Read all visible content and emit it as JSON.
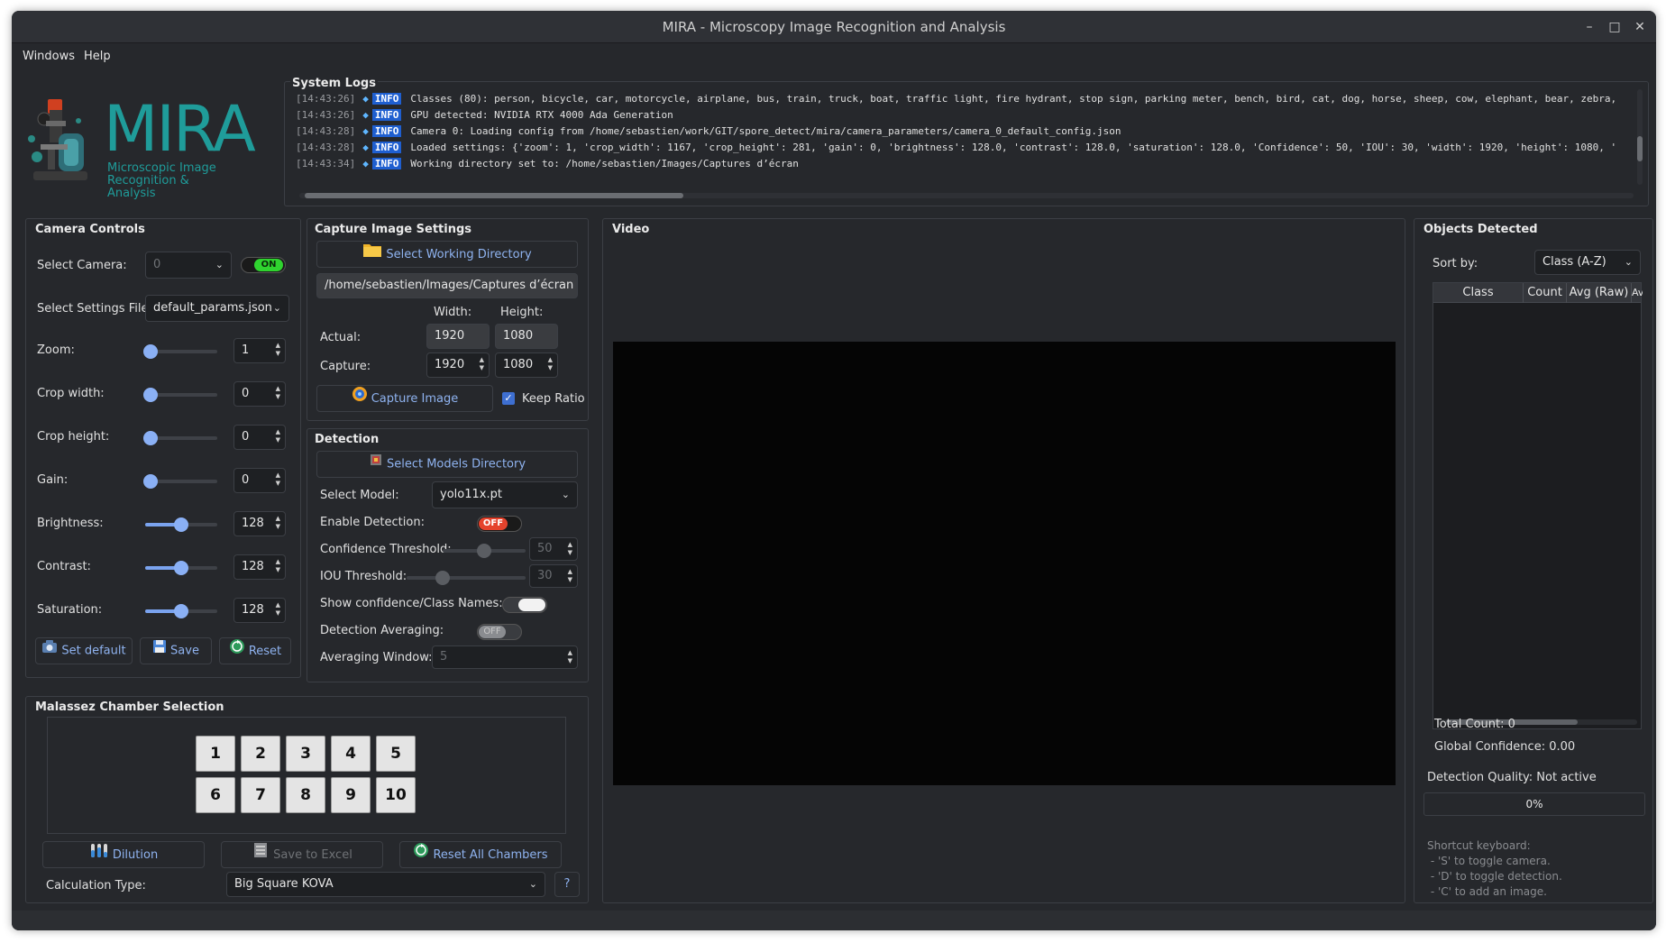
{
  "window": {
    "title": "MIRA - Microscopy Image Recognition and Analysis"
  },
  "menu": [
    "Windows",
    "Help"
  ],
  "logo": {
    "name": "MIRA",
    "subtitle_line1": "Microscopic Image",
    "subtitle_line2": "Recognition & Analysis"
  },
  "logs": {
    "title": "System Logs",
    "lines": [
      {
        "time": "[14:43:26]",
        "level": "INFO",
        "msg": "Classes (80): person, bicycle, car, motorcycle, airplane, bus, train, truck, boat, traffic light, fire hydrant, stop sign, parking meter, bench, bird, cat, dog, horse, sheep, cow, elephant, bear, zebra,"
      },
      {
        "time": "[14:43:26]",
        "level": "INFO",
        "msg": "GPU detected: NVIDIA RTX 4000 Ada Generation"
      },
      {
        "time": "[14:43:28]",
        "level": "INFO",
        "msg": "Camera 0: Loading config from /home/sebastien/work/GIT/spore_detect/mira/camera_parameters/camera_0_default_config.json"
      },
      {
        "time": "[14:43:28]",
        "level": "INFO",
        "msg": "Loaded settings: {'zoom': 1, 'crop_width': 1167, 'crop_height': 281, 'gain': 0, 'brightness': 128.0, 'contrast': 128.0, 'saturation': 128.0, 'Confidence': 50, 'IOU': 30, 'width': 1920, 'height': 1080, '"
      },
      {
        "time": "[14:43:34]",
        "level": "INFO",
        "msg": "Working directory set to: /home/sebastien/Images/Captures d’écran"
      }
    ]
  },
  "camera": {
    "title": "Camera Controls",
    "select_camera_label": "Select Camera:",
    "camera_value": "0",
    "camera_toggle": "ON",
    "settings_file_label": "Select Settings File:",
    "settings_file": "default_params.json",
    "sliders": [
      {
        "label": "Zoom:",
        "value": "1",
        "fraction": 0.0
      },
      {
        "label": "Crop width:",
        "value": "0",
        "fraction": 0.0
      },
      {
        "label": "Crop height:",
        "value": "0",
        "fraction": 0.0
      },
      {
        "label": "Gain:",
        "value": "0",
        "fraction": 0.0
      },
      {
        "label": "Brightness:",
        "value": "128",
        "fraction": 0.5
      },
      {
        "label": "Contrast:",
        "value": "128",
        "fraction": 0.5
      },
      {
        "label": "Saturation:",
        "value": "128",
        "fraction": 0.5
      }
    ],
    "set_default": "Set default",
    "save": "Save",
    "reset": "Reset"
  },
  "capture": {
    "title": "Capture Image Settings",
    "select_dir": "Select Working Directory",
    "dir_path": "/home/sebastien/Images/Captures d’écran",
    "width_label": "Width:",
    "height_label": "Height:",
    "actual_label": "Actual:",
    "actual_width": "1920",
    "actual_height": "1080",
    "capture_label": "Capture:",
    "capture_width": "1920",
    "capture_height": "1080",
    "capture_button": "Capture Image",
    "keep_ratio": "Keep Ratio"
  },
  "detection": {
    "title": "Detection",
    "select_models": "Select Models Directory",
    "select_model_label": "Select Model:",
    "model": "yolo11x.pt",
    "enable_label": "Enable Detection:",
    "enable_state": "OFF",
    "confidence_label": "Confidence Threshold:",
    "confidence_value": "50",
    "iou_label": "IOU Threshold:",
    "iou_value": "30",
    "show_names_label": "Show confidence/Class Names:",
    "averaging_label": "Detection Averaging:",
    "averaging_state": "OFF",
    "window_label": "Averaging Window:",
    "window_value": "5"
  },
  "video": {
    "title": "Video"
  },
  "objects": {
    "title": "Objects Detected",
    "sort_label": "Sort by:",
    "sort_value": "Class (A-Z)",
    "columns": [
      "Class",
      "Count",
      "Avg (Raw)",
      "Av"
    ],
    "total_count": "Total Count: 0",
    "global_confidence": "Global Confidence: 0.00",
    "detection_quality": "Detection Quality: Not active",
    "progress_text": "0%",
    "progress_value": 0,
    "shortcuts": [
      "Shortcut keyboard:",
      " - 'S' to toggle camera.",
      " - 'D' to toggle detection.",
      " - 'C' to add an image."
    ]
  },
  "malassez": {
    "title": "Malassez Chamber Selection",
    "chambers": [
      "1",
      "2",
      "3",
      "4",
      "5",
      "6",
      "7",
      "8",
      "9",
      "10"
    ],
    "dilution": "Dilution",
    "save_excel": "Save to Excel",
    "reset_all": "Reset All Chambers",
    "calc_label": "Calculation Type:",
    "calc_value": "Big Square KOVA",
    "help": "?"
  },
  "colors": {
    "accent": "#8fb3f0",
    "on": "#2fd32f",
    "off": "#e5432d",
    "logo_teal": "#1f9c9a",
    "background": "#26282c"
  }
}
